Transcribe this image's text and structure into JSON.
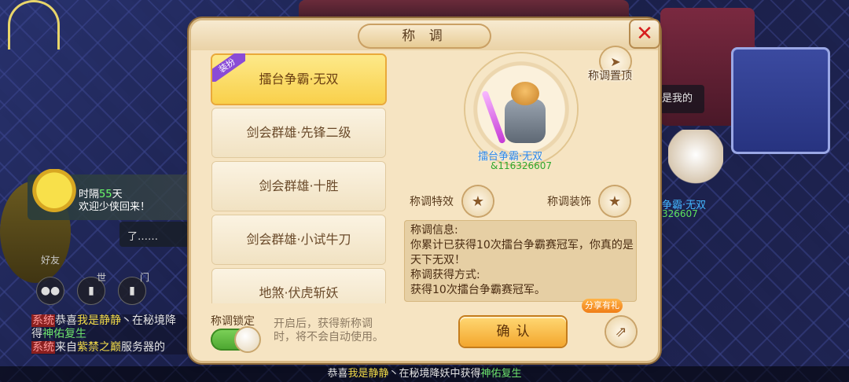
{
  "dialog": {
    "title": "称 调",
    "close_icon": "close-icon",
    "top_pin_label": "称调置顶",
    "list_tag": "装扮",
    "titles": [
      {
        "label": "擂台争霸·无双",
        "selected": true
      },
      {
        "label": "剑会群雄·先锋二级",
        "selected": false
      },
      {
        "label": "剑会群雄·十胜",
        "selected": false
      },
      {
        "label": "剑会群雄·小试牛刀",
        "selected": false
      },
      {
        "label": "地煞·伏虎斩妖",
        "selected": false
      }
    ],
    "character_name": "擂台争霸·无双",
    "character_uid": "&116326607",
    "effect_label": "称调特效",
    "decor_label": "称调装饰",
    "info_lines": [
      "称调信息:",
      "你累计已获得10次擂台争霸赛冠军，你真的是天下无双！",
      "称调获得方式:",
      "获得10次擂台争霸赛冠军。"
    ],
    "lock_label": "称调锁定",
    "lock_on": true,
    "lock_desc": "开启后，获得新称调时，将不会自动使用。",
    "confirm_label": "确认",
    "share_badge": "分享有礼",
    "share_icon": "share-icon"
  },
  "scene": {
    "welcome_prefix": "时隔",
    "welcome_days": "55",
    "welcome_suffix": "天",
    "welcome_line2": "欢迎少侠回来！",
    "small_bubble": "了……",
    "friends_label": "好友",
    "world_label": "世",
    "door_label": "门",
    "right_chat": "是我的",
    "right_name": "争霸·无双",
    "right_uid": "326607",
    "sys_tag": "系统",
    "sys_line1_a": "恭喜",
    "sys_line1_name": "我是静静",
    "sys_line1_b": "丶在秘境降",
    "sys_line2_a": "得",
    "sys_line2_item": "神佑复生",
    "sys_line3_a": "来自",
    "sys_line3_server": "紫禁之巅",
    "sys_line3_b": "服务器的",
    "ticker_a": "恭喜",
    "ticker_name": "我是静静",
    "ticker_b": "丶在秘境降妖中获得",
    "ticker_item": "神佑复生"
  }
}
